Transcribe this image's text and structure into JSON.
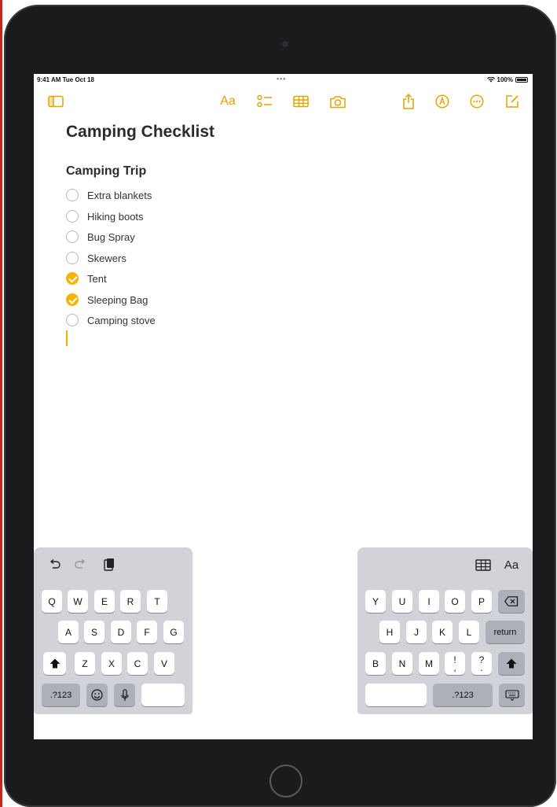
{
  "status_bar": {
    "time": "9:41 AM  Tue Oct 18",
    "dots": "•••",
    "battery": "100%"
  },
  "toolbar": {
    "sidebar_icon": "sidebar-icon",
    "format_label": "Aa",
    "checklist_icon": "checklist-icon",
    "table_icon": "table-icon",
    "camera_icon": "camera-icon",
    "share_icon": "share-icon",
    "markup_icon": "markup-icon",
    "more_icon": "more-icon",
    "compose_icon": "compose-icon",
    "accent_color": "#e0a400"
  },
  "note": {
    "title": "Camping Checklist",
    "heading": "Camping Trip",
    "items": [
      {
        "label": "Extra blankets",
        "checked": false
      },
      {
        "label": "Hiking boots",
        "checked": false
      },
      {
        "label": "Bug Spray",
        "checked": false
      },
      {
        "label": "Skewers",
        "checked": false
      },
      {
        "label": "Tent",
        "checked": true
      },
      {
        "label": "Sleeping Bag",
        "checked": true
      },
      {
        "label": "Camping stove",
        "checked": false
      }
    ]
  },
  "keyboard": {
    "left_tools": [
      "undo-icon",
      "redo-icon",
      "paste-icon"
    ],
    "right_tools": {
      "table_icon": "table-icon",
      "format_label": "Aa"
    },
    "left_rows": [
      [
        "Q",
        "W",
        "E",
        "R",
        "T"
      ],
      [
        "A",
        "S",
        "D",
        "F",
        "G"
      ],
      [
        "Z",
        "X",
        "C",
        "V"
      ]
    ],
    "right_rows": [
      [
        "Y",
        "U",
        "I",
        "O",
        "P"
      ],
      [
        "H",
        "J",
        "K",
        "L"
      ],
      [
        "B",
        "N",
        "M",
        "!",
        "?"
      ]
    ],
    "return_label": "return",
    "numbers_label": ".?123",
    "comma_alt": ",",
    "period_alt": "."
  }
}
